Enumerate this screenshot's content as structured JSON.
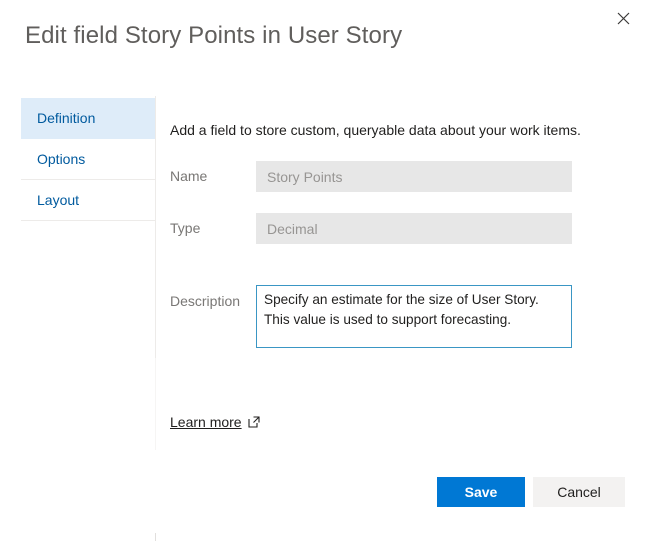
{
  "dialog": {
    "title": "Edit field Story Points in User Story",
    "close_icon": "close-icon"
  },
  "nav": {
    "items": [
      {
        "label": "Definition",
        "selected": true
      },
      {
        "label": "Options",
        "selected": false
      },
      {
        "label": "Layout",
        "selected": false
      }
    ]
  },
  "content": {
    "intro": "Add a field to store custom, queryable data about your work items.",
    "fields": {
      "name": {
        "label": "Name",
        "value": "Story Points",
        "placeholder": "Story Points",
        "disabled": true
      },
      "type": {
        "label": "Type",
        "value": "Decimal",
        "placeholder": "Decimal",
        "disabled": true
      },
      "description": {
        "label": "Description",
        "value": "Specify an estimate for the size of User Story. This value is used to support forecasting.",
        "placeholder": "",
        "focused": true
      }
    },
    "learn_more": {
      "label": "Learn more",
      "icon": "external-link-icon"
    }
  },
  "footer": {
    "save_label": "Save",
    "cancel_label": "Cancel"
  },
  "colors": {
    "accent": "#0078d4",
    "link": "#005a9e",
    "selected_tab_bg": "#deecf9",
    "disabled_input_bg": "#e7e7e7",
    "focus_border": "#3a96c4",
    "secondary_button_bg": "#f3f2f1"
  }
}
